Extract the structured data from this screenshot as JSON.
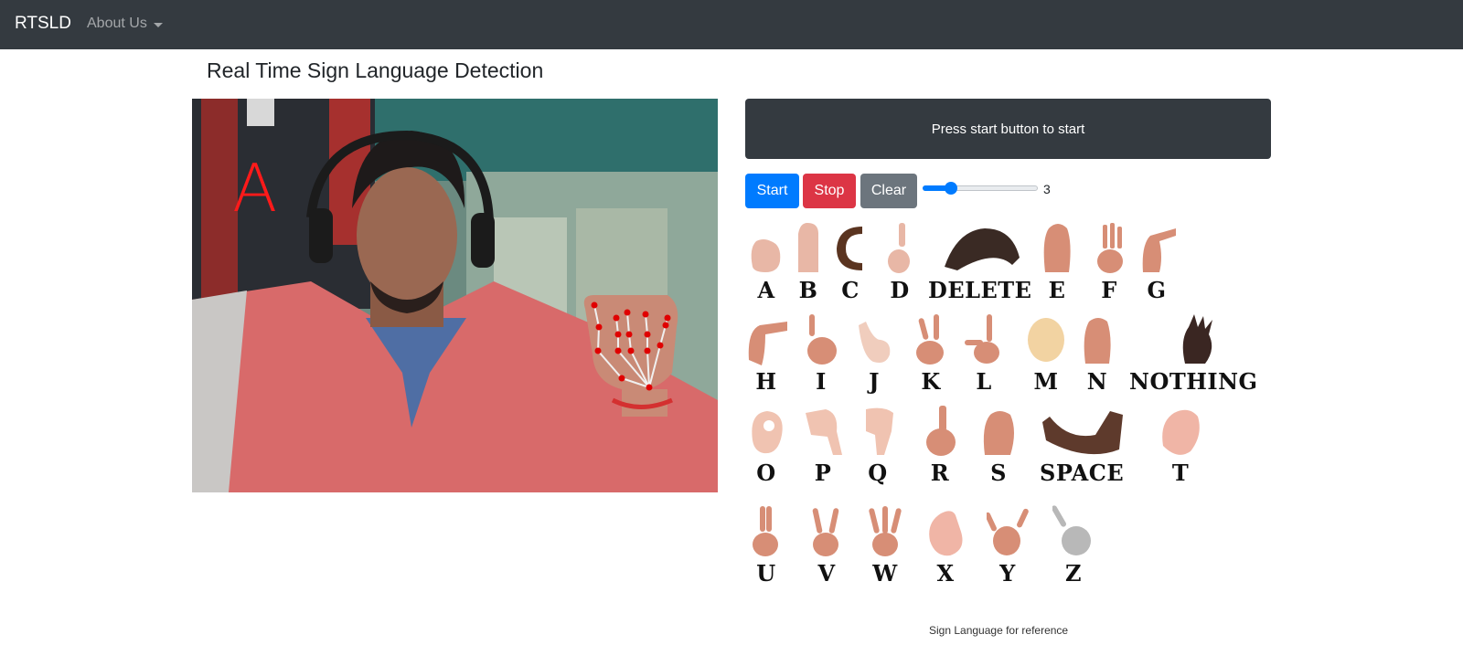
{
  "navbar": {
    "brand": "RTSLD",
    "about_label": "About Us"
  },
  "page": {
    "title": "Real Time Sign Language Detection"
  },
  "video": {
    "detected_letter": "A"
  },
  "output": {
    "message": "Press start button to start"
  },
  "controls": {
    "start_label": "Start",
    "stop_label": "Stop",
    "clear_label": "Clear",
    "slider_value": "3"
  },
  "reference": {
    "caption": "Sign Language for reference",
    "signs": [
      {
        "label": "A"
      },
      {
        "label": "B"
      },
      {
        "label": "C"
      },
      {
        "label": "D"
      },
      {
        "label": "DELETE"
      },
      {
        "label": "E"
      },
      {
        "label": "F"
      },
      {
        "label": "G"
      },
      {
        "label": "H"
      },
      {
        "label": "I"
      },
      {
        "label": "J"
      },
      {
        "label": "K"
      },
      {
        "label": "L"
      },
      {
        "label": "M"
      },
      {
        "label": "N"
      },
      {
        "label": "NOTHING"
      },
      {
        "label": "O"
      },
      {
        "label": "P"
      },
      {
        "label": "Q"
      },
      {
        "label": "R"
      },
      {
        "label": "S"
      },
      {
        "label": "SPACE"
      },
      {
        "label": "T"
      },
      {
        "label": "U"
      },
      {
        "label": "V"
      },
      {
        "label": "W"
      },
      {
        "label": "X"
      },
      {
        "label": "Y"
      },
      {
        "label": "Z"
      }
    ]
  },
  "colors": {
    "navbar": "#343a40",
    "start": "#007bff",
    "stop": "#dc3545",
    "clear": "#6c757d",
    "detected_letter": "#ff1a1a",
    "landmark": "#e00000"
  }
}
